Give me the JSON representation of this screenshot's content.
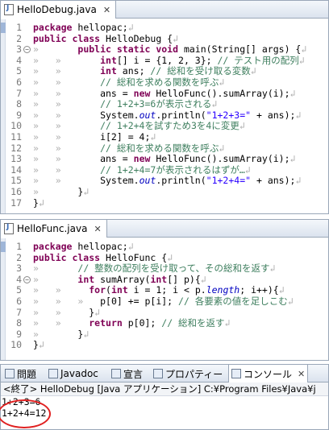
{
  "editor1": {
    "tab_label": "HelloDebug.java",
    "close_glyph": "✕",
    "lines": [
      {
        "num": "1",
        "fold": false,
        "html": "<span class=\"kw\">package</span> hellopac;<span class=\"ws\">↲</span>"
      },
      {
        "num": "2",
        "fold": false,
        "html": "<span class=\"kw\">public class</span> HelloDebug {<span class=\"ws\">↲</span>"
      },
      {
        "num": "3",
        "fold": true,
        "html": "<span class=\"ws\">»   </span>    <span class=\"kw\">public static void</span> main(String[] args) {<span class=\"ws\">↲</span>"
      },
      {
        "num": "4",
        "fold": false,
        "html": "<span class=\"ws\">»   »   </span>    <span class=\"kw\">int</span>[] i = {1, 2, 3}; <span class=\"cm\">// テスト用の配列</span><span class=\"ws\">↲</span>"
      },
      {
        "num": "5",
        "fold": false,
        "html": "<span class=\"ws\">»   »   </span>    <span class=\"kw\">int</span> ans; <span class=\"cm\">// 総和を受け取る変数</span><span class=\"ws\">↲</span>"
      },
      {
        "num": "6",
        "fold": false,
        "html": "<span class=\"ws\">»   »   </span>    <span class=\"cm\">// 総和を求める関数を呼ぶ</span><span class=\"ws\">↲</span>"
      },
      {
        "num": "7",
        "fold": false,
        "html": "<span class=\"ws\">»   »   </span>    ans = <span class=\"kw\">new</span> HelloFunc().sumArray(i);<span class=\"ws\">↲</span>"
      },
      {
        "num": "8",
        "fold": false,
        "html": "<span class=\"ws\">»   »   </span>    <span class=\"cm\">// 1+2+3=6が表示される</span><span class=\"ws\">↲</span>"
      },
      {
        "num": "9",
        "fold": false,
        "html": "<span class=\"ws\">»   »   </span>    System.<span class=\"it\">out</span>.println(<span class=\"st\">\"1+2+3=\"</span> + ans);<span class=\"ws\">↲</span>"
      },
      {
        "num": "10",
        "fold": false,
        "html": "<span class=\"ws\">»   »   </span>    <span class=\"cm\">// 1+2+4を試すため3を4に変更</span><span class=\"ws\">↲</span>"
      },
      {
        "num": "11",
        "fold": false,
        "html": "<span class=\"ws\">»   »   </span>    i[2] = 4;<span class=\"ws\">↲</span>"
      },
      {
        "num": "12",
        "fold": false,
        "html": "<span class=\"ws\">»   »   </span>    <span class=\"cm\">// 総和を求める関数を呼ぶ</span><span class=\"ws\">↲</span>"
      },
      {
        "num": "13",
        "fold": false,
        "html": "<span class=\"ws\">»   »   </span>    ans = <span class=\"kw\">new</span> HelloFunc().sumArray(i);<span class=\"ws\">↲</span>"
      },
      {
        "num": "14",
        "fold": false,
        "html": "<span class=\"ws\">»   »   </span>    <span class=\"cm\">// 1+2+4=7が表示されるはずが…</span><span class=\"ws\">↲</span>"
      },
      {
        "num": "15",
        "fold": false,
        "html": "<span class=\"ws\">»   »   </span>    System.<span class=\"it\">out</span>.println(<span class=\"st\">\"1+2+4=\"</span> + ans);<span class=\"ws\">↲</span>"
      },
      {
        "num": "16",
        "fold": false,
        "html": "<span class=\"ws\">»   </span>    }<span class=\"ws\">↲</span>"
      },
      {
        "num": "17",
        "fold": false,
        "html": "}<span class=\"ws\">↲</span>"
      }
    ]
  },
  "editor2": {
    "tab_label": "HelloFunc.java",
    "close_glyph": "✕",
    "lines": [
      {
        "num": "1",
        "fold": false,
        "html": "<span class=\"kw\">package</span> hellopac;<span class=\"ws\">↲</span>"
      },
      {
        "num": "2",
        "fold": false,
        "html": "<span class=\"kw\">public class</span> HelloFunc {<span class=\"ws\">↲</span>"
      },
      {
        "num": "3",
        "fold": false,
        "html": "<span class=\"ws\">»   </span>    <span class=\"cm\">// 整数の配列を受け取って、その総和を返す</span><span class=\"ws\">↲</span>"
      },
      {
        "num": "4",
        "fold": true,
        "html": "<span class=\"ws\">»   </span>    <span class=\"kw\">int</span> sumArray(<span class=\"kw\">int</span>[] p){<span class=\"ws\">↲</span>"
      },
      {
        "num": "5",
        "fold": false,
        "html": "<span class=\"ws\">»   »   </span>  <span class=\"kw\">for</span>(<span class=\"kw\">int</span> i = 1; i &lt; p.<span class=\"it\">length</span>; i++){<span class=\"ws\">↲</span>"
      },
      {
        "num": "6",
        "fold": false,
        "html": "<span class=\"ws\">»   »   »   </span>p[0] += p[i]; <span class=\"cm\">// 各要素の値を足しこむ</span><span class=\"ws\">↲</span>"
      },
      {
        "num": "7",
        "fold": false,
        "html": "<span class=\"ws\">»   »   </span>  }<span class=\"ws\">↲</span>"
      },
      {
        "num": "8",
        "fold": false,
        "html": "<span class=\"ws\">»   »   </span>  <span class=\"kw\">return</span> p[0]; <span class=\"cm\">// 総和を返す</span><span class=\"ws\">↲</span>"
      },
      {
        "num": "9",
        "fold": false,
        "html": "<span class=\"ws\">»   </span>    }<span class=\"ws\">↲</span>"
      },
      {
        "num": "10",
        "fold": false,
        "html": "}<span class=\"ws\">↲</span>"
      }
    ]
  },
  "console": {
    "tabs": [
      {
        "label": "問題",
        "icon": "problems-icon"
      },
      {
        "label": "Javadoc",
        "icon": "javadoc-icon"
      },
      {
        "label": "宣言",
        "icon": "declaration-icon"
      },
      {
        "label": "プロパティー",
        "icon": "properties-icon"
      },
      {
        "label": "コンソール",
        "icon": "console-icon",
        "close": "✕"
      }
    ],
    "header": "<終了> HelloDebug [Java アプリケーション] C:¥Program Files¥Java¥j",
    "output": [
      "1+2+3=6",
      "1+2+4=12"
    ]
  }
}
